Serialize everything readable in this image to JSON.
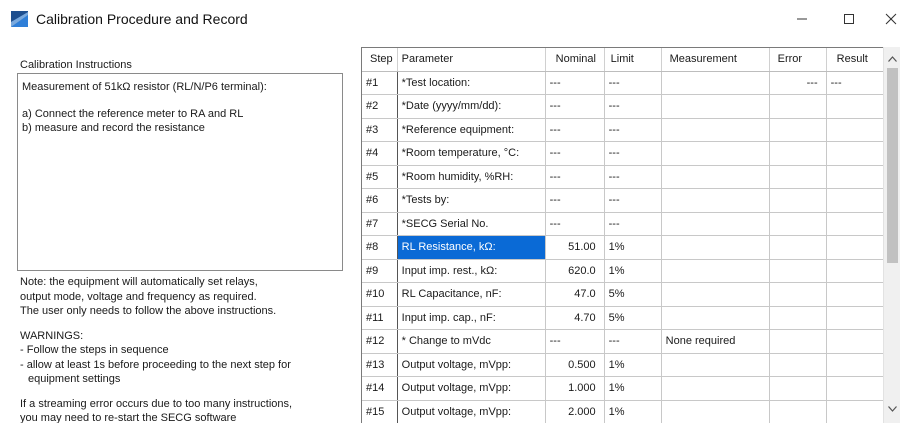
{
  "window": {
    "title": "Calibration Procedure and Record",
    "icon": "app-logo-icon",
    "controls": [
      "minimize-icon",
      "maximize-icon",
      "close-icon"
    ]
  },
  "instructions": {
    "heading": "Calibration Instructions",
    "lines": [
      "Measurement of 51kΩ resistor (RL/N/P6 terminal):",
      "a) Connect the reference meter to RA and RL",
      "b) measure and record the resistance"
    ]
  },
  "notes": {
    "note_lines": [
      "Note: the equipment will automatically set relays,",
      "output mode, voltage and frequency as required.",
      "The user only needs to follow the above instructions."
    ],
    "warnings_heading": "WARNINGS:",
    "warning_lines": [
      "- Follow the steps in sequence",
      "- allow at least 1s before proceeding to the next step for",
      "equipment settings"
    ],
    "error_lines": [
      "If a streaming error occurs due to too many instructions,",
      "you may need to re-start the SECG software"
    ]
  },
  "grid": {
    "columns": [
      "Step",
      "Parameter",
      "Nominal",
      "Limit",
      "Measurement",
      "Error",
      "Result"
    ],
    "selected_row": 7,
    "rows": [
      {
        "step": "#1",
        "parameter": "*Test location:",
        "nominal": "---",
        "limit": "---",
        "measurement": "",
        "error": "---",
        "result": "---"
      },
      {
        "step": "#2",
        "parameter": "*Date (yyyy/mm/dd):",
        "nominal": "---",
        "limit": "---",
        "measurement": "",
        "error": "",
        "result": ""
      },
      {
        "step": "#3",
        "parameter": "*Reference equipment:",
        "nominal": "---",
        "limit": "---",
        "measurement": "",
        "error": "",
        "result": ""
      },
      {
        "step": "#4",
        "parameter": "*Room temperature, °C:",
        "nominal": "---",
        "limit": "---",
        "measurement": "",
        "error": "",
        "result": ""
      },
      {
        "step": "#5",
        "parameter": "*Room humidity, %RH:",
        "nominal": "---",
        "limit": "---",
        "measurement": "",
        "error": "",
        "result": ""
      },
      {
        "step": "#6",
        "parameter": "*Tests by:",
        "nominal": "---",
        "limit": "---",
        "measurement": "",
        "error": "",
        "result": ""
      },
      {
        "step": "#7",
        "parameter": "*SECG Serial No.",
        "nominal": "---",
        "limit": "---",
        "measurement": "",
        "error": "",
        "result": ""
      },
      {
        "step": "#8",
        "parameter": "RL Resistance, kΩ:",
        "nominal": "51.00",
        "limit": "1%",
        "measurement": "",
        "error": "",
        "result": ""
      },
      {
        "step": "#9",
        "parameter": "Input imp. rest., kΩ:",
        "nominal": "620.0",
        "limit": "1%",
        "measurement": "",
        "error": "",
        "result": ""
      },
      {
        "step": "#10",
        "parameter": "RL Capacitance, nF:",
        "nominal": "47.0",
        "limit": "5%",
        "measurement": "",
        "error": "",
        "result": ""
      },
      {
        "step": "#11",
        "parameter": "Input imp. cap., nF:",
        "nominal": "4.70",
        "limit": "5%",
        "measurement": "",
        "error": "",
        "result": ""
      },
      {
        "step": "#12",
        "parameter": "* Change to mVdc",
        "nominal": "---",
        "limit": "---",
        "measurement": "None required",
        "error": "",
        "result": ""
      },
      {
        "step": "#13",
        "parameter": "Output voltage, mVpp:",
        "nominal": "0.500",
        "limit": "1%",
        "measurement": "",
        "error": "",
        "result": ""
      },
      {
        "step": "#14",
        "parameter": "Output voltage, mVpp:",
        "nominal": "1.000",
        "limit": "1%",
        "measurement": "",
        "error": "",
        "result": ""
      },
      {
        "step": "#15",
        "parameter": "Output voltage, mVpp:",
        "nominal": "2.000",
        "limit": "1%",
        "measurement": "",
        "error": "",
        "result": ""
      }
    ]
  },
  "scrollbar": {
    "up_icon": "scroll-up-icon",
    "down_icon": "scroll-down-icon"
  }
}
